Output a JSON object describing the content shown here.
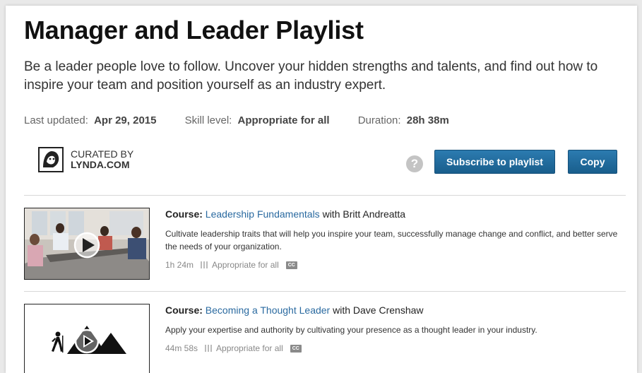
{
  "playlist": {
    "title": "Manager and Leader Playlist",
    "description": "Be a leader people love to follow. Uncover your hidden strengths and talents, and find out how to inspire your team and position yourself as an industry expert.",
    "meta": {
      "last_updated_label": "Last updated:",
      "last_updated_value": "Apr 29, 2015",
      "skill_label": "Skill level:",
      "skill_value": "Appropriate for all",
      "duration_label": "Duration:",
      "duration_value": "28h 38m"
    },
    "curator": {
      "line1": "CURATED BY",
      "line2": "LYNDA.COM"
    },
    "help_icon_glyph": "?",
    "subscribe_label": "Subscribe to playlist",
    "copy_label": "Copy"
  },
  "courses": [
    {
      "type_label": "Course:",
      "title": "Leadership Fundamentals",
      "with_text": "with",
      "author": "Britt Andreatta",
      "description": "Cultivate leadership traits that will help you inspire your team, successfully manage change and conflict, and better serve the needs of your organization.",
      "duration": "1h 24m",
      "level": "Appropriate for all",
      "cc": "CC"
    },
    {
      "type_label": "Course:",
      "title": "Becoming a Thought Leader",
      "with_text": "with",
      "author": "Dave Crenshaw",
      "description": "Apply your expertise and authority by cultivating your presence as a thought leader in your industry.",
      "duration": "44m 58s",
      "level": "Appropriate for all",
      "cc": "CC"
    }
  ],
  "colors": {
    "button_blue": "#1f6c9f",
    "link_blue": "#2a6aa0",
    "help_gray": "#c4c4c4"
  },
  "icons": [
    "lynda-logo-icon",
    "help-icon",
    "play-icon",
    "skill-level-icon",
    "closed-captions-icon",
    "hiker-icon"
  ]
}
